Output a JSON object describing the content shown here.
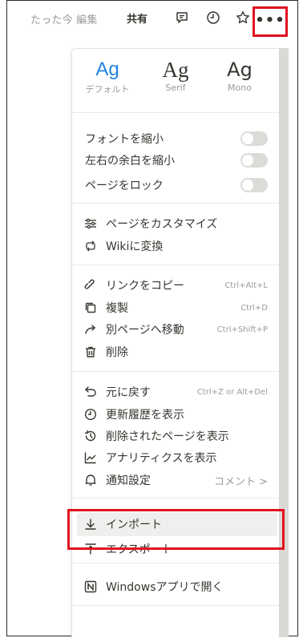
{
  "topbar": {
    "edited": "たった今 編集",
    "share": "共有",
    "more": "•••"
  },
  "fonts": [
    {
      "sample": "Ag",
      "name": "デフォルト"
    },
    {
      "sample": "Ag",
      "name": "Serif"
    },
    {
      "sample": "Ag",
      "name": "Mono"
    }
  ],
  "toggles": [
    {
      "label": "フォントを縮小"
    },
    {
      "label": "左右の余白を縮小"
    },
    {
      "label": "ページをロック"
    }
  ],
  "page_actions": [
    {
      "label": "ページをカスタマイズ",
      "icon": "customize-icon"
    },
    {
      "label": "Wikiに変換",
      "icon": "convert-icon"
    }
  ],
  "edit_actions": [
    {
      "label": "リンクをコピー",
      "shortcut": "Ctrl+Alt+L",
      "icon": "link-icon"
    },
    {
      "label": "複製",
      "shortcut": "Ctrl+D",
      "icon": "duplicate-icon"
    },
    {
      "label": "別ページへ移動",
      "shortcut": "Ctrl+Shift+P",
      "icon": "move-icon"
    },
    {
      "label": "削除",
      "shortcut": "",
      "icon": "trash-icon"
    }
  ],
  "history_actions": [
    {
      "label": "元に戻す",
      "shortcut": "Ctrl+Z or Alt+Del",
      "icon": "undo-icon"
    },
    {
      "label": "更新履歴を表示",
      "shortcut": "",
      "icon": "clock-icon"
    },
    {
      "label": "削除されたページを表示",
      "shortcut": "",
      "icon": "restore-icon"
    },
    {
      "label": "アナリティクスを表示",
      "shortcut": "",
      "icon": "analytics-icon"
    },
    {
      "label": "通知設定",
      "shortcut": "コメント >",
      "icon": "bell-icon"
    }
  ],
  "import_export": [
    {
      "label": "インポート",
      "icon": "download-icon"
    },
    {
      "label": "エクスポート",
      "icon": "upload-icon"
    }
  ],
  "open_in_app": {
    "label": "Windowsアプリで開く",
    "icon": "notion-app-icon"
  },
  "colors": {
    "accent": "#2383e2",
    "highlight": "#e0101d"
  }
}
